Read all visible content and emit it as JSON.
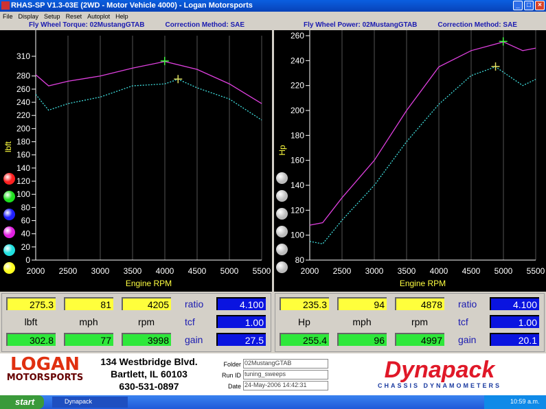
{
  "window": {
    "title": "RHAS-SP V1.3-03E  (2WD - Motor Vehicle 4000) - Logan Motorsports"
  },
  "menu": [
    "File",
    "Display",
    "Setup",
    "Reset",
    "Autoplot",
    "Help"
  ],
  "left_header": {
    "title": "Fly Wheel Torque: 02MustangGTAB",
    "correction": "Correction Method: SAE"
  },
  "right_header": {
    "title": "Fly Wheel Power: 02MustangGTAB",
    "correction": "Correction Method: SAE"
  },
  "chart_data": [
    {
      "type": "line",
      "xlabel": "Engine RPM",
      "ylabel": "lbft",
      "xlim": [
        2000,
        5500
      ],
      "ylim": [
        0,
        310
      ],
      "xticks": [
        2000,
        2500,
        3000,
        3500,
        4000,
        4500,
        5000,
        5500
      ],
      "yticks": [
        0,
        20,
        40,
        60,
        80,
        100,
        120,
        140,
        160,
        180,
        200,
        220,
        240,
        260,
        280,
        310
      ],
      "grid": true,
      "series": [
        {
          "color": "#e040e0",
          "x": [
            2000,
            2200,
            2500,
            3000,
            3500,
            4000,
            4500,
            5000,
            5500
          ],
          "y": [
            282,
            265,
            272,
            280,
            292,
            302,
            290,
            268,
            238
          ]
        },
        {
          "color": "#40e0e0",
          "dashed": true,
          "x": [
            2000,
            2200,
            2500,
            3000,
            3500,
            4000,
            4205,
            4500,
            5000,
            5500
          ],
          "y": [
            252,
            228,
            238,
            248,
            265,
            268,
            275,
            262,
            245,
            213
          ]
        }
      ],
      "markers": [
        {
          "x": 3998,
          "y": 302.8,
          "color": "#40ff40"
        },
        {
          "x": 4205,
          "y": 275.3,
          "color": "#e0e060"
        }
      ],
      "color_buttons": [
        "#ff2020",
        "#20e020",
        "#2020ff",
        "#e020e0",
        "#20e0e0",
        "#ffff20"
      ]
    },
    {
      "type": "line",
      "xlabel": "Engine RPM",
      "ylabel": "Hp",
      "xlim": [
        2000,
        5500
      ],
      "ylim": [
        80,
        260
      ],
      "xticks": [
        2000,
        2500,
        3000,
        3500,
        4000,
        4500,
        5000,
        5500
      ],
      "yticks": [
        80,
        100,
        120,
        140,
        160,
        180,
        200,
        220,
        240,
        260
      ],
      "grid": true,
      "series": [
        {
          "color": "#e040e0",
          "x": [
            2000,
            2200,
            2500,
            3000,
            3500,
            4000,
            4500,
            5000,
            5300,
            5500
          ],
          "y": [
            108,
            110,
            130,
            160,
            200,
            235,
            248,
            255,
            248,
            250
          ]
        },
        {
          "color": "#40e0e0",
          "dashed": true,
          "x": [
            2000,
            2200,
            2500,
            3000,
            3500,
            4000,
            4500,
            4878,
            5300,
            5500
          ],
          "y": [
            95,
            93,
            112,
            140,
            175,
            205,
            228,
            235,
            220,
            225
          ]
        }
      ],
      "markers": [
        {
          "x": 4997,
          "y": 255.4,
          "color": "#40ff40"
        },
        {
          "x": 4878,
          "y": 235.3,
          "color": "#e0e060"
        }
      ]
    }
  ],
  "left_panel": {
    "top": [
      "275.3",
      "81",
      "4205"
    ],
    "units": [
      "lbft",
      "mph",
      "rpm"
    ],
    "bottom": [
      "302.8",
      "77",
      "3998"
    ],
    "ratio_label": "ratio",
    "ratio": "4.100",
    "tcf_label": "tcf",
    "tcf": "1.00",
    "gain_label": "gain",
    "gain": "27.5"
  },
  "right_panel": {
    "top": [
      "235.3",
      "94",
      "4878"
    ],
    "units": [
      "Hp",
      "mph",
      "rpm"
    ],
    "bottom": [
      "255.4",
      "96",
      "4997"
    ],
    "ratio_label": "ratio",
    "ratio": "4.100",
    "tcf_label": "tcf",
    "tcf": "1.00",
    "gain_label": "gain",
    "gain": "20.1"
  },
  "footer": {
    "logo": "LOGAN MOTORSPORTS",
    "address": [
      "134 Westbridge Blvd.",
      "Bartlett, IL 60103",
      "630-531-0897"
    ],
    "folder_label": "Folder",
    "folder": "02MustangGTAB",
    "runid_label": "Run ID",
    "runid": "tuning_sweeps",
    "date_label": "Date",
    "date": "24-May-2006  14:42:31",
    "brand": "Dynapack",
    "brand_sub": "CHASSIS  DYNAMOMETERS"
  },
  "taskbar": {
    "start": "start",
    "task": "Dynapack",
    "clock": "10:59 a.m."
  }
}
